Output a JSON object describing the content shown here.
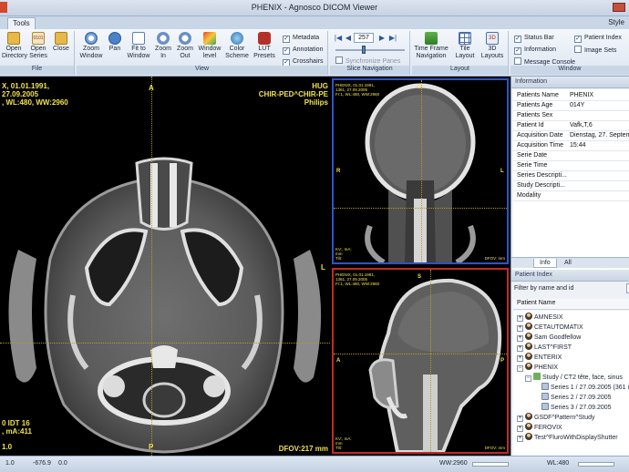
{
  "window": {
    "title": "PHENIX - Agnosco DICOM Viewer"
  },
  "tabs": {
    "tools": "Tools",
    "style": "Style"
  },
  "file_group": {
    "label": "File",
    "open_directory": "Open Directory",
    "open_series": "Open Series",
    "close": "Close",
    "series_icon_text": "0101"
  },
  "view_group": {
    "label": "View",
    "zoom_window": "Zoom Window",
    "pan": "Pan",
    "fit_to_window": "Fit to Window",
    "zoom_in": "Zoom In",
    "zoom_out": "Zoom Out",
    "window_level": "Window level",
    "color_scheme": "Color Scheme",
    "lut_presets": "LUT Presets",
    "metadata": "Metadata",
    "annotation": "Annotation",
    "crosshairs": "Crosshairs"
  },
  "slice_group": {
    "label": "Slice Navigation",
    "slice_value": "257",
    "slider_fraction": 0.4,
    "first": "|◀",
    "prev": "◀",
    "next": "▶",
    "last": "▶|",
    "synchronize_panes": "Synchronize Panes"
  },
  "layout_group": {
    "label": "Layout",
    "time_frame": "Time Frame Navigation",
    "tile_layout": "Tile Layout",
    "layouts_3d": "3D Layouts",
    "layouts_3d_icon_text": "3D"
  },
  "window_group": {
    "label": "Window",
    "status_bar": "Status Bar",
    "patient_index": "Patient Index",
    "information": "Information",
    "image_sets": "Image Sets",
    "message_console": "Message Console"
  },
  "axial_overlay": {
    "top_left_1": "X, 01.01.1991,",
    "top_left_2": "27.09.2005",
    "top_left_3": ", WL:480, WW:2960",
    "top_right_1": "HUG",
    "top_right_2": "CHIR-PED^CHIR-PE",
    "top_right_3": "Philips",
    "orient_top": "A",
    "orient_bottom": "P",
    "orient_right": "L",
    "bottom_left_1": "0 IDT 16",
    "bottom_left_2": ", mA:411",
    "bottom_left_3": "1.0",
    "bottom_right": "DFOV:217 mm"
  },
  "coronal_overlay": {
    "tl_1": "PHENIX, 01.01.1991,",
    "tl_2": "1361, 27.09.2005",
    "tl_3": "Fr:1, WL:480, WW:2960",
    "orient_top": "S",
    "orient_left": "R",
    "orient_right": "L",
    "bl_1": "KV:, mA:",
    "bl_2": "mm",
    "bl_3": "Tilt:",
    "br": "DFOV: mm"
  },
  "sagittal_overlay": {
    "tl_1": "PHENIX, 01.01.1991,",
    "tl_2": "1361, 27.09.2005",
    "tl_3": "Fr:1, WL:480, WW:2960",
    "orient_top": "S",
    "orient_left": "A",
    "orient_right": "P",
    "bl_1": "KV:, mA:",
    "bl_2": "mm",
    "bl_3": "Tilt:",
    "br": "DFOV: mm"
  },
  "info_panel": {
    "title": "Information",
    "rows": [
      {
        "k": "Patients Name",
        "v": "PHENIX"
      },
      {
        "k": "Patients Age",
        "v": "014Y"
      },
      {
        "k": "Patients Sex",
        "v": ""
      },
      {
        "k": "Patient Id",
        "v": "Vafk,T,6"
      },
      {
        "k": "Acquisition Date",
        "v": "Dienstag, 27. Septem"
      },
      {
        "k": "Acquisition Time",
        "v": "15:44"
      },
      {
        "k": "Serie Date",
        "v": ""
      },
      {
        "k": "Serie Time",
        "v": ""
      },
      {
        "k": "Series Descripti...",
        "v": ""
      },
      {
        "k": "Study Descripti...",
        "v": ""
      },
      {
        "k": "Modality",
        "v": ""
      }
    ],
    "tab_info": "Info",
    "tab_all": "All"
  },
  "patient_index": {
    "title": "Patient Index",
    "filter_label": "Filter by name and id",
    "column": "Patient Name",
    "nodes": [
      {
        "label": "AMNESIX",
        "exp": "+",
        "icon": "person",
        "indent": 0
      },
      {
        "label": "CETAUTOMATIX",
        "exp": "+",
        "icon": "person",
        "indent": 0
      },
      {
        "label": "Sam Goodfellow",
        "exp": "+",
        "icon": "person",
        "indent": 0
      },
      {
        "label": "LAST^FIRST",
        "exp": "+",
        "icon": "person",
        "indent": 0
      },
      {
        "label": "ENTERIX",
        "exp": "+",
        "icon": "person",
        "indent": 0
      },
      {
        "label": "PHENIX",
        "exp": "−",
        "icon": "person",
        "indent": 0
      },
      {
        "label": "Study  / CT2 tête, face, sinus",
        "exp": "−",
        "icon": "study",
        "indent": 1
      },
      {
        "label": "Series 1 / 27.09.2005 (361 imag",
        "exp": "",
        "icon": "series",
        "indent": 2
      },
      {
        "label": "Series 2 / 27.09.2005",
        "exp": "",
        "icon": "series",
        "indent": 2
      },
      {
        "label": "Series 3 / 27.09.2005",
        "exp": "",
        "icon": "series",
        "indent": 2
      },
      {
        "label": "GSDF^Pattern^Study",
        "exp": "+",
        "icon": "person",
        "indent": 0
      },
      {
        "label": "FEROVIX",
        "exp": "+",
        "icon": "person",
        "indent": 0
      },
      {
        "label": "Test^FluroWithDisplayShutter",
        "exp": "+",
        "icon": "person",
        "indent": 0
      }
    ]
  },
  "statusbar": {
    "zoom": "1.0",
    "x": "-676.9",
    "y": "0.0",
    "ww": "WW:2960",
    "wl": "WL:480"
  }
}
